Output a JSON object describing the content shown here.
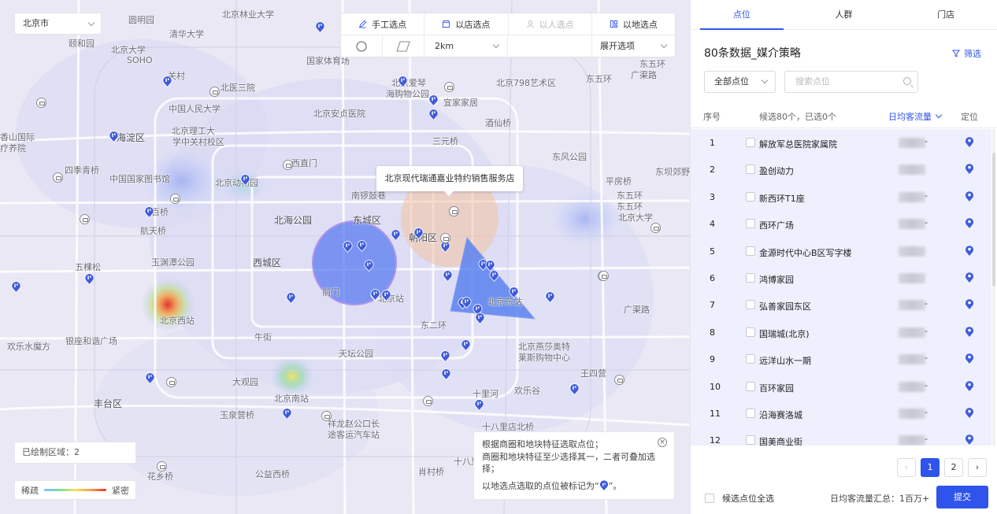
{
  "map": {
    "city_select": "北京市",
    "toolbar": {
      "manual": "手工选点",
      "by_store": "以店选点",
      "by_people": "以人选点",
      "by_land": "以地选点",
      "radius": "2km",
      "expand": "展开选项"
    },
    "tooltip": "北京现代瑞通嘉业特约销售服务店",
    "area_count": "已绘制区域：2",
    "legend": {
      "sparse": "稀疏",
      "dense": "紧密"
    },
    "info": {
      "line1": "根据商圈和地块特征选取点位；",
      "line2": "商圈和地块特征至少选择其一，二者可叠加选择；",
      "line3_prefix": "以地选点选取的点位被标记为“",
      "line3_suffix": "”。",
      "close": "×"
    },
    "labels": [
      {
        "t": "圆明园"
      },
      {
        "t": "北京林业大学"
      },
      {
        "t": "颐和园"
      },
      {
        "t": "清华大学"
      },
      {
        "t": "北京大学"
      },
      {
        "t": "关村"
      },
      {
        "t": "北医三院"
      },
      {
        "t": "中国人民大学"
      },
      {
        "t": "北京理工大"
      },
      {
        "t": "学中关村校区"
      },
      {
        "t": "海淀区"
      },
      {
        "t": "香山国际"
      },
      {
        "t": "疗养院"
      },
      {
        "t": "四季青桥"
      },
      {
        "t": "中国国家图书馆"
      },
      {
        "t": "北京动物园"
      },
      {
        "t": "西直门"
      },
      {
        "t": "百桥"
      },
      {
        "t": "航天桥"
      },
      {
        "t": "玉渊潭公园"
      },
      {
        "t": "西城区"
      },
      {
        "t": "五棵松"
      },
      {
        "t": "北京西站"
      },
      {
        "t": "欢乐水魔方"
      },
      {
        "t": "银座和谐广场"
      },
      {
        "t": "丰台区"
      },
      {
        "t": "大观园"
      },
      {
        "t": "牛街"
      },
      {
        "t": "北京南站"
      },
      {
        "t": "天坛公园"
      },
      {
        "t": "玉泉营桥"
      },
      {
        "t": "花乡桥"
      },
      {
        "t": "公益西桥"
      },
      {
        "t": "祥龙赵公口长"
      },
      {
        "t": "途客运汽车站"
      },
      {
        "t": "国家体育场"
      },
      {
        "t": "北京安贞医院"
      },
      {
        "t": "北京爱琴"
      },
      {
        "t": "海购物公园"
      },
      {
        "t": "宜家家居"
      },
      {
        "t": "北京798艺术区"
      },
      {
        "t": "东五环"
      },
      {
        "t": "三元桥"
      },
      {
        "t": "酒仙桥"
      },
      {
        "t": "东风公园"
      },
      {
        "t": "平房桥"
      },
      {
        "t": "东坝郊野"
      },
      {
        "t": "北海公园"
      },
      {
        "t": "东城区"
      },
      {
        "t": "南锣鼓巷"
      },
      {
        "t": "朝阳区"
      },
      {
        "t": "前门"
      },
      {
        "t": "北京站"
      },
      {
        "t": "北京东站"
      },
      {
        "t": "广渠路"
      },
      {
        "t": "北京燕莎奥特"
      },
      {
        "t": "莱斯购物中心"
      },
      {
        "t": "东二环"
      },
      {
        "t": "王四营"
      },
      {
        "t": "欢乐谷"
      },
      {
        "t": "十里河"
      },
      {
        "t": "十八里店北桥"
      },
      {
        "t": "十八里"
      },
      {
        "t": "肖村桥"
      },
      {
        "t": "东五环"
      },
      {
        "t": "东五环"
      },
      {
        "t": "广渠路"
      },
      {
        "t": "东五环"
      },
      {
        "t": "东五环"
      },
      {
        "t": "北京大学"
      },
      {
        "t": "SOHO"
      },
      {
        "t": "东五环"
      }
    ]
  },
  "panel": {
    "tabs": [
      "点位",
      "人群",
      "门店"
    ],
    "title": "80条数据_媒介策略",
    "filter": "筛选",
    "all_points": "全部点位",
    "search_placeholder": "搜索点位",
    "columns": {
      "index": "序号",
      "summary": "候选80个，已选0个",
      "flow": "日均客流量",
      "locate": "定位"
    },
    "rows": [
      {
        "idx": "1",
        "name": "解放军总医院家属院",
        "dash": "-"
      },
      {
        "idx": "2",
        "name": "盈创动力",
        "dash": ""
      },
      {
        "idx": "3",
        "name": "新西环T1座",
        "dash": "-"
      },
      {
        "idx": "4",
        "name": "西环广场",
        "dash": "-"
      },
      {
        "idx": "5",
        "name": "金源时代中心B区写字楼",
        "dash": ""
      },
      {
        "idx": "6",
        "name": "鸿博家园",
        "dash": ""
      },
      {
        "idx": "7",
        "name": "弘善家园东区",
        "dash": "-"
      },
      {
        "idx": "8",
        "name": "国瑞城(北京)",
        "dash": "-"
      },
      {
        "idx": "9",
        "name": "远洋山水一期",
        "dash": "-"
      },
      {
        "idx": "10",
        "name": "百环家园",
        "dash": "-"
      },
      {
        "idx": "11",
        "name": "沿海赛洛城",
        "dash": "-"
      },
      {
        "idx": "12",
        "name": "国美商业街",
        "dash": "-"
      }
    ],
    "pager": {
      "prev": "‹",
      "pages": [
        "1",
        "2"
      ],
      "next": "›",
      "current": "1"
    },
    "select_all": "候选点位全选",
    "total": "日均客流量汇总：1百万+",
    "submit": "提交"
  },
  "colors": {
    "accent": "#2f54eb",
    "pin": "#3f5bdc",
    "circle": "#5a7cf0"
  }
}
